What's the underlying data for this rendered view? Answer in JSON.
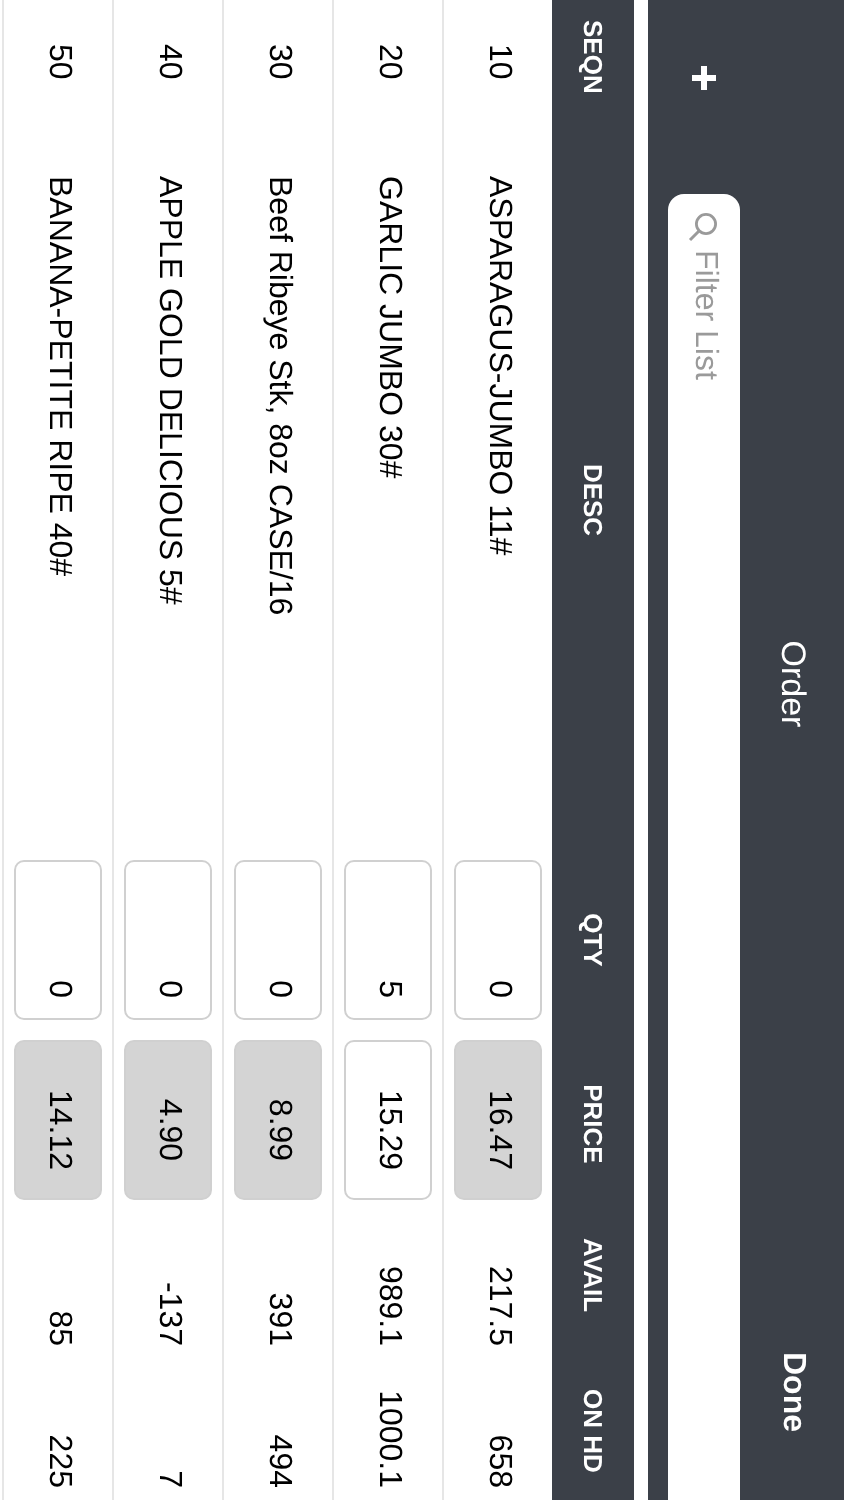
{
  "nav": {
    "title": "Order",
    "done": "Done"
  },
  "filter": {
    "placeholder": "Filter List"
  },
  "columns": [
    "SEQN",
    "DESC",
    "QTY",
    "PRICE",
    "AVAIL",
    "ON HD"
  ],
  "rows": [
    {
      "seqn": "10",
      "desc": "ASPARAGUS-JUMBO 11#",
      "qty": "0",
      "price": {
        "value": "16.47",
        "disabled": true
      },
      "avail": "217.5",
      "on_hand": "658"
    },
    {
      "seqn": "20",
      "desc": "GARLIC JUMBO 30#",
      "qty": "5",
      "price": {
        "value": "15.29",
        "disabled": false
      },
      "avail": "989.1",
      "on_hand": "1000.1"
    },
    {
      "seqn": "30",
      "desc": "Beef Ribeye Stk, 8oz CASE/16",
      "qty": "0",
      "price": {
        "value": "8.99",
        "disabled": true
      },
      "avail": "391",
      "on_hand": "494"
    },
    {
      "seqn": "40",
      "desc": "APPLE GOLD DELICIOUS 5#",
      "qty": "0",
      "price": {
        "value": "4.90",
        "disabled": true
      },
      "avail": "-137",
      "on_hand": "7"
    },
    {
      "seqn": "50",
      "desc": "BANANA-PETITE RIPE 40#",
      "qty": "0",
      "price": {
        "value": "14.12",
        "disabled": true
      },
      "avail": "85",
      "on_hand": "225"
    }
  ]
}
